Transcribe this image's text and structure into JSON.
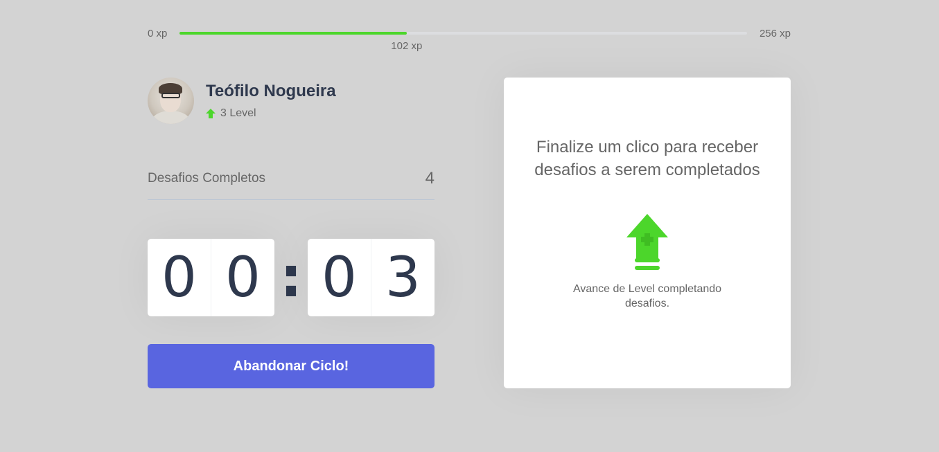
{
  "experience": {
    "min_label": "0 xp",
    "max_label": "256 xp",
    "current_label": "102 xp",
    "progress": 0.4
  },
  "profile": {
    "name": "Teófilo Nogueira",
    "level_label": "3 Level"
  },
  "challenges": {
    "label": "Desafios Completos",
    "count": "4"
  },
  "countdown": {
    "minute_left": "0",
    "minute_right": "0",
    "separator": ":",
    "second_left": "0",
    "second_right": "3"
  },
  "actions": {
    "abandon_label": "Abandonar Ciclo!"
  },
  "challenge_box": {
    "title": "Finalize um clico para receber desafios a serem completados",
    "subtitle": "Avance de Level completando desafios."
  },
  "colors": {
    "accent_green": "#4cd62b",
    "button_blue": "#5965e0",
    "title_dark": "#2e384d",
    "background": "#d3d3d3"
  },
  "icons": {
    "level": "level-up-arrow-icon",
    "box": "level-up-icon"
  }
}
